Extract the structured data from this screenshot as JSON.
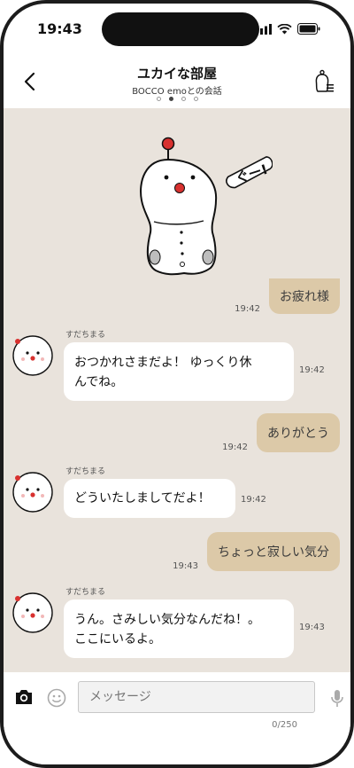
{
  "status": {
    "time": "19:43"
  },
  "header": {
    "title": "ユカイな部屋",
    "subtitle": "BOCCO emoとの会話",
    "page_dots": 4,
    "active_dot": 1
  },
  "sticker": {
    "caption": "ぐー!"
  },
  "messages": [
    {
      "side": "right",
      "text": "お疲れ様",
      "time": "19:42"
    },
    {
      "side": "left",
      "sender": "すだちまる",
      "text_line1": "おつかれさまだよ！ ゆっくり休",
      "text_line2": "んでね。",
      "time": "19:42"
    },
    {
      "side": "right",
      "text": "ありがとう",
      "time": "19:42"
    },
    {
      "side": "left",
      "sender": "すだちまる",
      "text_line1": "どういたしましてだよ！",
      "time": "19:42"
    },
    {
      "side": "right",
      "text": "ちょっと寂しい気分",
      "time": "19:43"
    },
    {
      "side": "left",
      "sender": "すだちまる",
      "text_line1": "うん。さみしい気分なんだね！。",
      "text_line2": "ここにいるよ。",
      "time": "19:43"
    }
  ],
  "composer": {
    "placeholder": "メッセージ",
    "counter": "0/250"
  },
  "colors": {
    "chat_bg": "#e9e3dc",
    "bubble_right": "#dcc9a8",
    "bubble_left": "#ffffff",
    "robot_red": "#d8312f"
  },
  "icons": [
    "back-arrow-icon",
    "robot-menu-icon",
    "camera-icon",
    "emoji-icon",
    "microphone-icon",
    "signal-icon",
    "wifi-icon",
    "battery-icon"
  ]
}
